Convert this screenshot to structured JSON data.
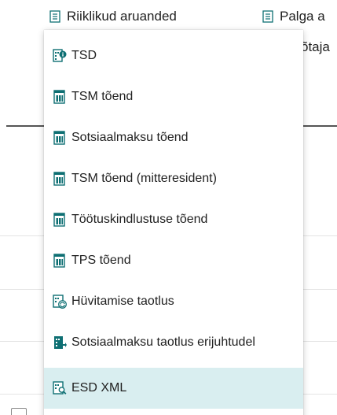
{
  "actionbar": {
    "items": [
      {
        "label": "Riiklikud aruanded",
        "icon": "document-icon"
      },
      {
        "label": "Palga a",
        "icon": "document-icon"
      }
    ],
    "partial_text": "õtaja"
  },
  "menu": {
    "items": [
      {
        "label": "TSD",
        "icon": "report-info-icon"
      },
      {
        "label": "TSM tõend",
        "icon": "report-icon"
      },
      {
        "label": "Sotsiaalmaksu tõend",
        "icon": "report-icon"
      },
      {
        "label": "TSM tõend (mitteresident)",
        "icon": "report-icon"
      },
      {
        "label": "Töötuskindlustuse tõend",
        "icon": "report-icon"
      },
      {
        "label": "TPS tõend",
        "icon": "report-icon"
      },
      {
        "label": "Hüvitamise taotlus",
        "icon": "report-refresh-icon"
      },
      {
        "label": "Sotsiaalmaksu taotlus erijuhtudel",
        "icon": "report-export-icon"
      },
      {
        "label": "ESD XML",
        "icon": "report-search-icon",
        "selected": true
      }
    ]
  },
  "colors": {
    "icon_teal": "#0e6f73",
    "selected_bg": "#d9eef0"
  }
}
